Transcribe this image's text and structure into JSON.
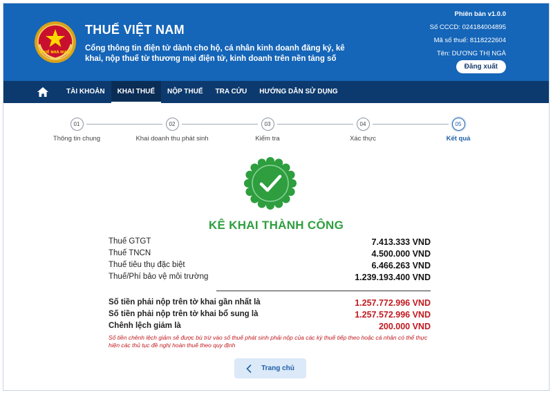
{
  "header": {
    "title": "THUẾ VIỆT NAM",
    "subtitle": "Cổng thông tin điện tử dành cho hộ, cá nhân kinh doanh đăng ký, kê khai, nộp thuế từ thương mại điện tử, kinh doanh trên nền tảng số",
    "version": "Phiên bản v1.0.0",
    "cccd": "Số CCCD: 024184004895",
    "tax_code": "Mã số thuế: 8118222604",
    "name": "Tên: DƯƠNG THỊ NGÀ",
    "logout_label": "Đăng xuất",
    "emblem_text": "THUẾ NHÀ NƯỚC",
    "brand_color": "#1565b8"
  },
  "nav": {
    "home_icon": "home-icon",
    "items": [
      "TÀI KHOẢN",
      "KHAI THUẾ",
      "NỘP THUẾ",
      "TRA CỨU",
      "HƯỚNG DẪN SỬ DỤNG"
    ],
    "active_index": 1
  },
  "steps": [
    {
      "num": "01",
      "label": "Thông tin chung"
    },
    {
      "num": "02",
      "label": "Khai doanh thu phát sinh"
    },
    {
      "num": "03",
      "label": "Kiểm tra"
    },
    {
      "num": "04",
      "label": "Xác thực"
    },
    {
      "num": "05",
      "label": "Kết quả"
    }
  ],
  "active_step": 4,
  "result": {
    "title": "KÊ KHAI THÀNH CÔNG",
    "icon": "check-badge-icon",
    "success_color": "#2e9e3f"
  },
  "taxes": [
    {
      "label": "Thuế GTGT",
      "value": "7.413.333 VND"
    },
    {
      "label": "Thuế TNCN",
      "value": "4.500.000 VND"
    },
    {
      "label": "Thuế tiêu thụ đặc biệt",
      "value": "6.466.263 VND"
    },
    {
      "label": "Thuế/Phí bảo vệ môi trường",
      "value": "1.239.193.400 VND"
    }
  ],
  "summary": [
    {
      "label": "Số tiền phải nộp trên tờ khai gần nhất là",
      "value": "1.257.772.996 VND"
    },
    {
      "label": "Số tiền phải nộp trên tờ khai bổ sung là",
      "value": "1.257.572.996 VND"
    },
    {
      "label": "Chênh lệch giảm là",
      "value": "200.000 VND"
    }
  ],
  "note": "Số tiền chênh lệch giảm sẽ được bù trừ vào số thuế phát sinh phải nộp của các kỳ thuế tiếp theo hoặc cá nhân có thể thực hiện các thủ tục đề nghị hoàn thuế theo quy định",
  "home_button": {
    "label": "Trang chủ",
    "icon": "chevron-left-icon"
  },
  "alert_color": "#c0191f"
}
